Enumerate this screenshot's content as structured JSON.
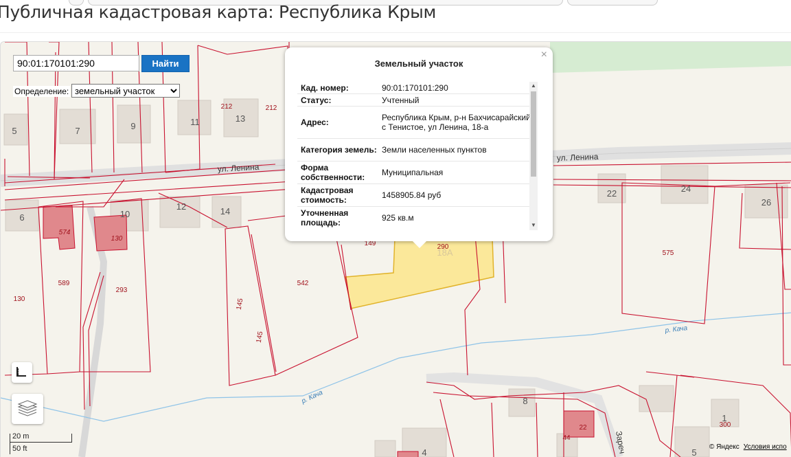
{
  "page": {
    "title": "Публичная кадастровая карта: Республика Крым"
  },
  "search": {
    "value": "90:01:170101:290",
    "button_label": "Найти",
    "definition_label": "Определение:",
    "definition_selected": "земельный участок"
  },
  "popup": {
    "title": "Земельный участок",
    "close_symbol": "×",
    "rows": [
      {
        "key": "Кад. номер:",
        "value": "90:01:170101:290"
      },
      {
        "key": "Статус:",
        "value": "Учтенный"
      },
      {
        "key": "Адрес:",
        "value": "Республика Крым, р-н Бахчисарайский, с Тенистое, ул Ленина, 18-а"
      },
      {
        "key": "Категория земель:",
        "value": "Земли населенных пунктов"
      },
      {
        "key": "Форма собственности:",
        "value": "Муниципальная"
      },
      {
        "key": "Кадастровая стоимость:",
        "value": "1458905.84 руб"
      },
      {
        "key": "Уточненная площадь:",
        "value": "925 кв.м"
      }
    ]
  },
  "map": {
    "streets": [
      "ул. Ленина",
      "ул. Ленина",
      "р. Кача",
      "р. Кача",
      "Зареч"
    ],
    "house_numbers": [
      "5",
      "7",
      "9",
      "11",
      "13",
      "6",
      "10",
      "12",
      "14",
      "22",
      "24",
      "26",
      "18А",
      "8",
      "4",
      "5",
      "1"
    ],
    "parcel_numbers": [
      "212",
      "212",
      "574",
      "130",
      "589",
      "293",
      "130",
      "145",
      "145",
      "542",
      "575",
      "290",
      "149",
      "44",
      "22",
      "300"
    ],
    "selected_parcel_color": "#fbe89a",
    "boundary_color": "#c8102e",
    "icons": [
      "ruler-icon",
      "layers-icon"
    ]
  },
  "scale": {
    "metric": "20 m",
    "imperial": "50 ft"
  },
  "attribution": {
    "copyright": "© Яндекс",
    "terms": "Условия испо"
  }
}
